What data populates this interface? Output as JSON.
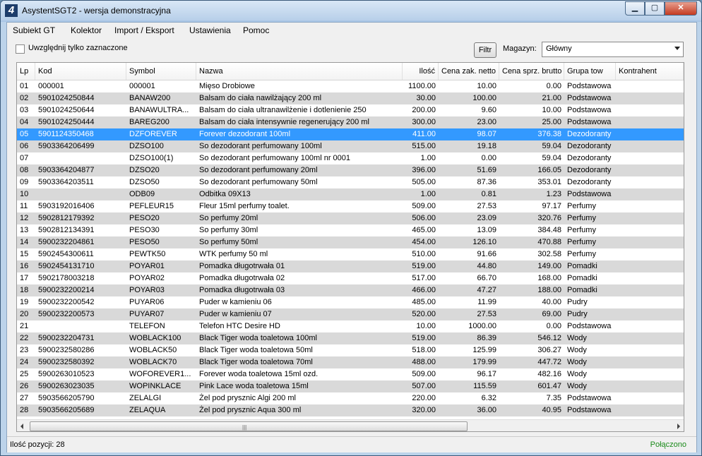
{
  "window": {
    "title": "AsystentSGT2 - wersja demonstracyjna",
    "icon": "4"
  },
  "menu": [
    "Subiekt GT",
    "Kolektor",
    "Import / Eksport",
    "Ustawienia",
    "Pomoc"
  ],
  "toolbar": {
    "checkbox_label": "Uwzględnij tylko zaznaczone",
    "filter_button": "Filtr",
    "warehouse_label": "Magazyn:",
    "warehouse_value": "Główny"
  },
  "columns": [
    "Lp",
    "Kod",
    "Symbol",
    "Nazwa",
    "Ilość",
    "Cena zak. netto",
    "Cena sprz. brutto",
    "Grupa tow",
    "Kontrahent"
  ],
  "selected_row": 4,
  "rows": [
    [
      "01",
      "000001",
      "000001",
      "Mięso Drobiowe",
      "1100.00",
      "10.00",
      "0.00",
      "Podstawowa",
      ""
    ],
    [
      "02",
      "5901024250844",
      "BANAW200",
      "Balsam do ciała nawilżający 200 ml",
      "30.00",
      "100.00",
      "21.00",
      "Podstawowa",
      ""
    ],
    [
      "03",
      "5901024250644",
      "BANAWULTRA...",
      "Balsam do ciała ultranawilżenie i dotlenienie 250",
      "200.00",
      "9.60",
      "10.00",
      "Podstawowa",
      ""
    ],
    [
      "04",
      "5901024250444",
      "BAREG200",
      "Balsam do ciała intensywnie regenerujący 200 ml",
      "300.00",
      "23.00",
      "25.00",
      "Podstawowa",
      ""
    ],
    [
      "05",
      "5901124350468",
      "DZFOREVER",
      "Forever dezodorant 100ml",
      "411.00",
      "98.07",
      "376.38",
      "Dezodoranty",
      ""
    ],
    [
      "06",
      "5903364206499",
      "DZSO100",
      "So dezodorant perfumowany 100ml",
      "515.00",
      "19.18",
      "59.04",
      "Dezodoranty",
      ""
    ],
    [
      "07",
      "",
      "DZSO100(1)",
      "So dezodorant perfumowany 100ml nr 0001",
      "1.00",
      "0.00",
      "59.04",
      "Dezodoranty",
      ""
    ],
    [
      "08",
      "5903364204877",
      "DZSO20",
      "So dezodorant perfumowany 20ml",
      "396.00",
      "51.69",
      "166.05",
      "Dezodoranty",
      ""
    ],
    [
      "09",
      "5903364203511",
      "DZSO50",
      "So dezodorant perfumowany 50ml",
      "505.00",
      "87.36",
      "353.01",
      "Dezodoranty",
      ""
    ],
    [
      "10",
      "",
      "ODB09",
      "Odbitka 09X13",
      "1.00",
      "0.81",
      "1.23",
      "Podstawowa",
      ""
    ],
    [
      "11",
      "5903192016406",
      "PEFLEUR15",
      "Fleur 15ml perfumy toalet.",
      "509.00",
      "27.53",
      "97.17",
      "Perfumy",
      ""
    ],
    [
      "12",
      "5902812179392",
      "PESO20",
      "So perfumy 20ml",
      "506.00",
      "23.09",
      "320.76",
      "Perfumy",
      ""
    ],
    [
      "13",
      "5902812134391",
      "PESO30",
      "So perfumy 30ml",
      "465.00",
      "13.09",
      "384.48",
      "Perfumy",
      ""
    ],
    [
      "14",
      "5900232204861",
      "PESO50",
      "So perfumy 50ml",
      "454.00",
      "126.10",
      "470.88",
      "Perfumy",
      ""
    ],
    [
      "15",
      "5902454300611",
      "PEWTK50",
      "WTK perfumy 50 ml",
      "510.00",
      "91.66",
      "302.58",
      "Perfumy",
      ""
    ],
    [
      "16",
      "5902454131710",
      "POYAR01",
      "Pomadka długotrwała 01",
      "519.00",
      "44.80",
      "149.00",
      "Pomadki",
      ""
    ],
    [
      "17",
      "5902178003218",
      "POYAR02",
      "Pomadka długotrwała 02",
      "517.00",
      "66.70",
      "168.00",
      "Pomadki",
      ""
    ],
    [
      "18",
      "5900232200214",
      "POYAR03",
      "Pomadka długotrwała 03",
      "466.00",
      "47.27",
      "188.00",
      "Pomadki",
      ""
    ],
    [
      "19",
      "5900232200542",
      "PUYAR06",
      "Puder w kamieniu 06",
      "485.00",
      "11.99",
      "40.00",
      "Pudry",
      ""
    ],
    [
      "20",
      "5900232200573",
      "PUYAR07",
      "Puder w kamieniu 07",
      "520.00",
      "27.53",
      "69.00",
      "Pudry",
      ""
    ],
    [
      "21",
      "",
      "TELEFON",
      "Telefon HTC Desire HD",
      "10.00",
      "1000.00",
      "0.00",
      "Podstawowa",
      ""
    ],
    [
      "22",
      "5900232204731",
      "WOBLACK100",
      "Black Tiger woda toaletowa 100ml",
      "519.00",
      "86.39",
      "546.12",
      "Wody",
      ""
    ],
    [
      "23",
      "5900232580286",
      "WOBLACK50",
      "Black Tiger woda toaletowa 50ml",
      "518.00",
      "125.99",
      "306.27",
      "Wody",
      ""
    ],
    [
      "24",
      "5900232580392",
      "WOBLACK70",
      "Black Tiger woda toaletowa 70ml",
      "488.00",
      "179.99",
      "447.72",
      "Wody",
      ""
    ],
    [
      "25",
      "5900263010523",
      "WOFOREVER1...",
      "Forever woda toaletowa 15ml ozd.",
      "509.00",
      "96.17",
      "482.16",
      "Wody",
      ""
    ],
    [
      "26",
      "5900263023035",
      "WOPINKLACE",
      "Pink Lace woda toaletowa 15ml",
      "507.00",
      "115.59",
      "601.47",
      "Wody",
      ""
    ],
    [
      "27",
      "5903566205790",
      "ZELALGI",
      "Żel pod prysznic Algi 200 ml",
      "220.00",
      "6.32",
      "7.35",
      "Podstawowa",
      ""
    ],
    [
      "28",
      "5903566205689",
      "ZELAQUA",
      "Żel pod prysznic Aqua 300 ml",
      "320.00",
      "36.00",
      "40.95",
      "Podstawowa",
      ""
    ]
  ],
  "status": {
    "left": "Ilość pozycji: 28",
    "right": "Połączono"
  }
}
